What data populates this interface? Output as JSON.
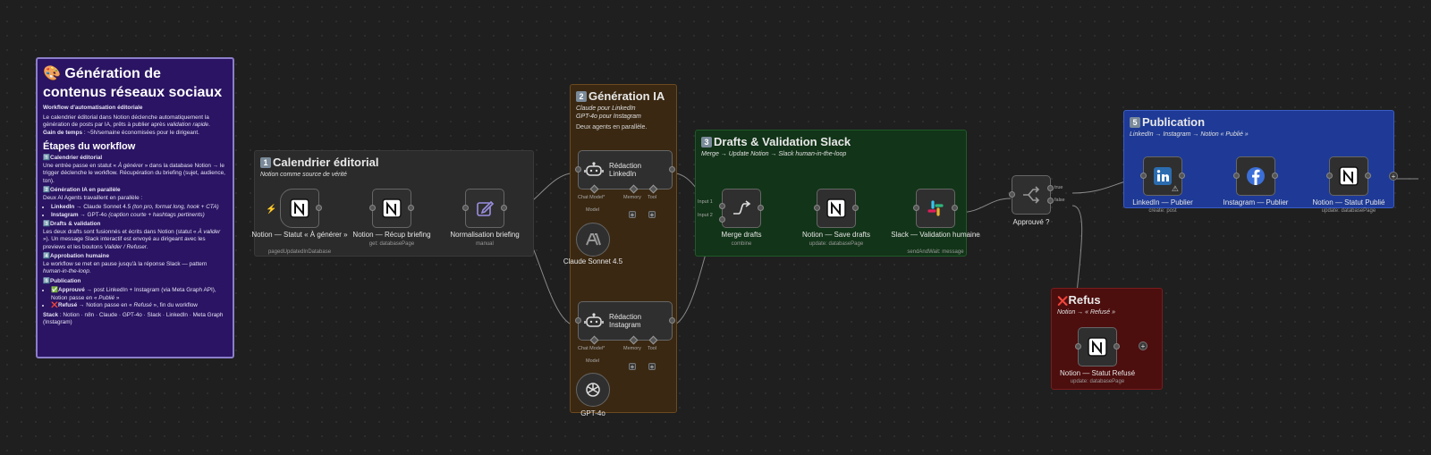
{
  "info": {
    "title": "🎨 Génération de contenus réseaux sociaux",
    "subtitle": "Workflow d'automatisation éditoriale",
    "intro_a": "Le calendrier éditorial dans Notion déclenche automatiquement la génération de posts par IA, prêts à publier après ",
    "intro_em": "validation rapide",
    "intro_b": ".",
    "gain_label": "Gain de temps",
    "gain_text": " : ~5h/semaine économisées pour le dirigeant.",
    "steps_heading": "Étapes du workflow",
    "s1_title": "Calendrier éditorial",
    "s1_a": "Une entrée passe en statut « ",
    "s1_em": "À générer",
    "s1_b": " » dans la database Notion → le trigger déclenche le workflow. Récupération du briefing (sujet, audience, ton).",
    "s2_title": "Génération IA en parallèle",
    "s2_text": "Deux AI Agents travaillent en parallèle :",
    "s2_li1_b": "LinkedIn",
    "s2_li1_t": " → Claude Sonnet 4.5 ",
    "s2_li1_em": "(ton pro, format long, hook + CTA)",
    "s2_li2_b": "Instagram",
    "s2_li2_t": " → GPT-4o ",
    "s2_li2_em": "(caption courte + hashtags pertinents)",
    "s3_title": "Drafts & validation",
    "s3_a": "Les deux drafts sont fusionnés et écrits dans Notion (statut « ",
    "s3_em": "À valider",
    "s3_b": " »). Un message Slack interactif est envoyé au dirigeant avec les previews et les boutons ",
    "s3_em2": "Valider / Refuser",
    "s3_c": ".",
    "s4_title": "Approbation humaine",
    "s4_a": "Le workflow se met en pause jusqu'à la réponse Slack — pattern ",
    "s4_em": "human-in-the-loop",
    "s4_b": ".",
    "s5_title": "Publication",
    "s5_li1_b": "✅Approuvé",
    "s5_li1_t": " → post LinkedIn + Instagram (via Meta Graph API), Notion passe en « ",
    "s5_li1_em": "Publié",
    "s5_li1_c": " »",
    "s5_li2_b": "❌Refusé",
    "s5_li2_t": " → Notion passe en « ",
    "s5_li2_em": "Refusé",
    "s5_li2_c": " », fin du workflow",
    "stack_label": "Stack",
    "stack_text": " : Notion · n8n · Claude · GPT-4o · Slack · LinkedIn · Meta Graph (Instagram)",
    "n1": "1️⃣",
    "n2": "2️⃣",
    "n3": "3️⃣",
    "n4": "4️⃣",
    "n5": "5️⃣"
  },
  "stickies": {
    "s1": {
      "num": "1",
      "title": "Calendrier éditorial",
      "sub": "Notion comme source de vérité"
    },
    "s2": {
      "num": "2",
      "title": "Génération IA",
      "sub1": "Claude pour LinkedIn",
      "sub2": "GPT-4o pour Instagram",
      "text": "Deux agents en parallèle."
    },
    "s3": {
      "num": "3",
      "title": "Drafts & Validation Slack",
      "sub": "Merge → Update Notion → Slack human-in-the-loop"
    },
    "s5": {
      "num": "5",
      "title": "Publication",
      "sub": "LinkedIn → Instagram → Notion « Publié »"
    },
    "refus": {
      "icon": "❌",
      "title": "Refus",
      "sub": "Notion → « Refusé »"
    }
  },
  "nodes": {
    "trigger": {
      "label": "Notion — Statut « À générer »",
      "sub": "pagedUpdatedInDatabase"
    },
    "recup": {
      "label": "Notion — Récup briefing",
      "sub": "get: databasePage"
    },
    "norm": {
      "label": "Normalisation briefing",
      "sub": "manual"
    },
    "agent_li": {
      "label": "Rédaction LinkedIn"
    },
    "agent_ig": {
      "label": "Rédaction Instagram"
    },
    "claude": {
      "label": "Claude Sonnet 4.5"
    },
    "gpt": {
      "label": "GPT-4o"
    },
    "merge": {
      "label": "Merge drafts",
      "sub": "combine",
      "in1": "Input 1",
      "in2": "Input 2"
    },
    "save": {
      "label": "Notion — Save drafts",
      "sub": "update: databasePage"
    },
    "slack": {
      "label": "Slack — Validation humaine",
      "sub": "sendAndWait: message"
    },
    "approve": {
      "label": "Approuvé ?",
      "true_label": "true",
      "false_label": "false"
    },
    "li_pub": {
      "label": "LinkedIn — Publier",
      "sub": "create: post"
    },
    "ig_pub": {
      "label": "Instagram — Publier",
      "sub": ""
    },
    "notion_pub": {
      "label": "Notion — Statut Publié",
      "sub": "update: databasePage"
    },
    "notion_ref": {
      "label": "Notion — Statut Refusé",
      "sub": "update: databasePage"
    }
  },
  "agent_ports": {
    "chat_model": "Chat Model*",
    "memory": "Memory",
    "tool": "Tool",
    "model": "Model"
  },
  "colors": {
    "canvas": "#1f1f1f",
    "info_bg": "#2a1463",
    "sticky1": "#2b2b2b",
    "sticky2": "#3a2812",
    "sticky3": "#123418",
    "sticky5": "#1e3a96",
    "refus": "#4d0e0e",
    "linkedin": "#2b6cb0",
    "facebook": "#3b6fd8"
  },
  "icons": {
    "trigger": "lightning-icon",
    "notion": "notion-logo-icon",
    "edit": "pencil-edit-icon",
    "agent": "robot-icon",
    "anthropic": "anthropic-logo-icon",
    "openai": "openai-logo-icon",
    "merge": "merge-icon",
    "slack": "slack-logo-icon",
    "if": "branch-icon",
    "linkedin": "linkedin-logo-icon",
    "facebook": "facebook-logo-icon",
    "warning": "warning-icon"
  },
  "plus_symbol": "+"
}
